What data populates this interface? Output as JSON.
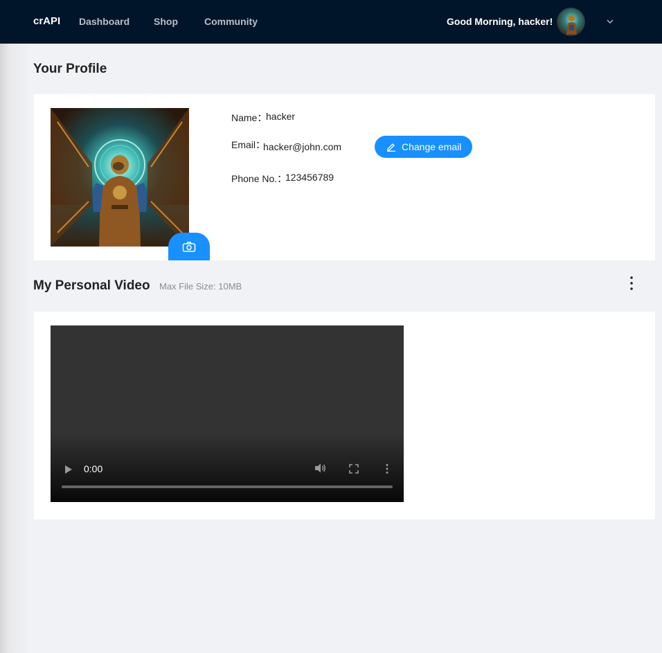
{
  "nav": {
    "brand": "crAPI",
    "links": [
      "Dashboard",
      "Shop",
      "Community"
    ],
    "greeting": "Good Morning, hacker!",
    "avatar_icon": "user-avatar",
    "dropdown_icon": "chevron-down-icon"
  },
  "profile": {
    "title": "Your Profile",
    "name_label": "Name",
    "name_value": "hacker",
    "email_label": "Email",
    "email_value": "hacker@john.com",
    "change_email_label": "Change email",
    "phone_label": "Phone No.",
    "phone_value": "123456789"
  },
  "video": {
    "title": "My Personal Video",
    "subtitle": "Max File Size: 10MB",
    "time": "0:00"
  },
  "colors": {
    "nav_bg": "#001529",
    "primary": "#1890ff",
    "page_bg": "#f0f2f5"
  }
}
